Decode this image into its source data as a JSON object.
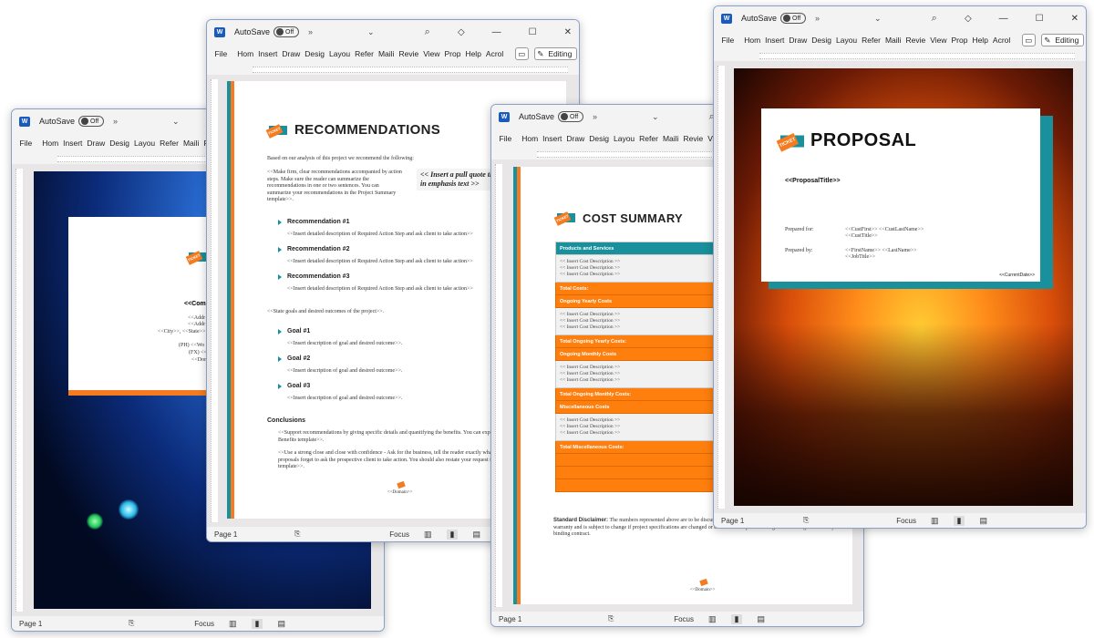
{
  "common": {
    "app_icon": "word-icon",
    "autosave_label": "AutoSave",
    "autosave_state": "Off",
    "more_glyph": "»",
    "dropdown_glyph": "⌄",
    "search_glyph": "⌕",
    "diamond_glyph": "◇",
    "min_glyph": "—",
    "max_glyph": "☐",
    "close_glyph": "✕",
    "ribbon_tabs": [
      "File",
      "Hom",
      "Insert",
      "Draw",
      "Desig",
      "Layou",
      "Refer",
      "Maili",
      "Revie",
      "View",
      "Prop",
      "Help",
      "Acrol"
    ],
    "comment_glyph": "▭",
    "editing_label": "Editing",
    "status_page": "Page 1",
    "focus_label": "Focus",
    "accessibility_glyph": "⎘",
    "view_read": "▥",
    "view_print": "▮",
    "view_web": "▤"
  },
  "windows": {
    "cover": {
      "company": "<<Comp",
      "address_lines": [
        "<<Addr",
        "<<Addr",
        "<<City>>, <<State>>"
      ],
      "contact_lines": [
        "(PH) <<Wo",
        "(FX) <<",
        "<<Dom"
      ]
    },
    "recommendations": {
      "heading": "RECOMMENDATIONS",
      "intro": "Based on our analysis of this project we recommend the following:",
      "para": "<<Make firm, clear recommendations accompanied by action steps.  Make sure the reader can summarize the recommendations in one or two sentences.  You can summarize your recommendations in the Project Summary template>>.",
      "pull_quote": "<< Insert a pull quote that will be in emphasis text >>",
      "recommendations": [
        {
          "title": "Recommendation #1",
          "desc": "<<Insert detailed description of Required Action Step and ask client to take action>>"
        },
        {
          "title": "Recommendation #2",
          "desc": "<<Insert detailed description of Required Action Step and ask client to take action>>"
        },
        {
          "title": "Recommendation #3",
          "desc": "<<Insert detailed description of Required Action Step and ask client to take action>>"
        }
      ],
      "goals_intro": "<<State goals and desired outcomes of the project>>.",
      "goals": [
        {
          "title": "Goal #1",
          "desc": "<<Insert description of goal and desired outcome>>."
        },
        {
          "title": "Goal #2",
          "desc": "<<Insert description of goal and desired outcome>>."
        },
        {
          "title": "Goal #3",
          "desc": "<<Insert description of goal and desired outcome>>."
        }
      ],
      "conclusions_heading": "Conclusions",
      "conclusion_1": "<<Support recommendations by giving specific details and quantifying the benefits.  You can expand on the benefits by adding the Benefits template>>.",
      "conclusion_2": "<<Use a strong close and close with confidence - Ask for the business, tell the reader exactly what you want him or her to do.  Many proposals forget to ask the prospective client to take action. You should also restate your request for action in the Project Summary template>>.",
      "footer_domain": "<<Domain>>"
    },
    "cost_summary": {
      "heading": "COST SUMMARY",
      "sections": [
        {
          "header": "Products and Services",
          "header_style": "teal",
          "rows": [
            "<< Insert Cost Description >>",
            "<< Insert Cost Description >>",
            "<< Insert Cost Description >>"
          ],
          "total": "Total Costs:"
        },
        {
          "header": "Ongoing Yearly Costs",
          "header_style": "orange",
          "rows": [
            "<< Insert Cost Description >>",
            "<< Insert Cost Description >>",
            "<< Insert Cost Description >>"
          ],
          "total": "Total Ongoing Yearly Costs:"
        },
        {
          "header": "Ongoing Monthly Costs",
          "header_style": "orange",
          "rows": [
            "<< Insert Cost Description >>",
            "<< Insert Cost Description >>",
            "<< Insert Cost Description >>"
          ],
          "total": "Total Ongoing Monthly Costs:"
        },
        {
          "header": "Miscellaneous Costs",
          "header_style": "orange",
          "rows": [
            "<< Insert Cost Description >>",
            "<< Insert Cost Description >>",
            "<< Insert Cost Description >>"
          ],
          "total": "Total Miscellaneous Costs:"
        }
      ],
      "disclaimer_label": "Standard Disclaimer:",
      "disclaimer_text": "The numbers represented above are to be discussed. The above Cost Summary does in no way constitute a warranty and is subject to change if project specifications are changed or costs for third parties change before being locked in by a binding contract.",
      "footer_domain": "<<Domain>>"
    },
    "proposal": {
      "heading": "PROPOSAL",
      "proposal_title": "<<ProposalTitle>>",
      "prepared_for_label": "Prepared for:",
      "prepared_for_line1": "<<CustFirst>> <<CustLastName>>",
      "prepared_for_line2": "<<CustTitle>>",
      "prepared_by_label": "Prepared by:",
      "prepared_by_line1": "<<FirstName>> <<LastName>>",
      "prepared_by_line2": "<<JobTitle>>",
      "current_date": "<<CurrentDate>>"
    }
  },
  "colors": {
    "teal": "#19909b",
    "orange": "#f47b20",
    "word_blue": "#185abd"
  },
  "ticket_label": "TICKET"
}
